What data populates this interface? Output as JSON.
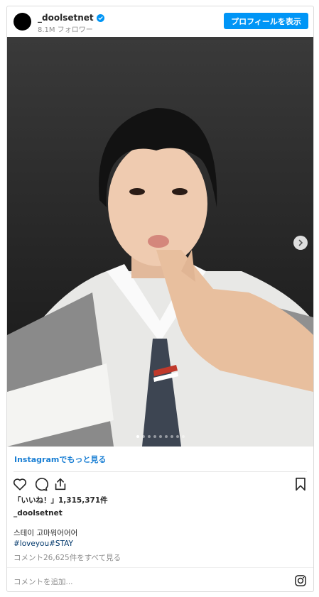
{
  "header": {
    "username": "_doolsetnet",
    "followers": "8.1M フォロワー",
    "profile_button": "プロフィールを表示"
  },
  "post": {
    "carousel_total": 9,
    "carousel_active": 1,
    "more_link": "Instagramでもっと見る",
    "likes": "「いいね！」1,315,371件",
    "caption_user": "_doolsetnet",
    "caption_text": "스테이 고마워어어어",
    "hashtags": "#loveyou#STAY",
    "comments_link": "コメント26,625件をすべて見る",
    "add_comment_placeholder": "コメントを追加..."
  },
  "icons": {
    "verified": "verified-badge-icon",
    "next": "chevron-right-icon",
    "like": "heart-icon",
    "comment": "comment-icon",
    "share": "share-icon",
    "save": "bookmark-icon",
    "instagram": "instagram-logo-icon"
  },
  "colors": {
    "accent": "#0095f6",
    "link": "#1a7fd4",
    "hashtag": "#00376b",
    "muted": "#8e8e8e"
  }
}
